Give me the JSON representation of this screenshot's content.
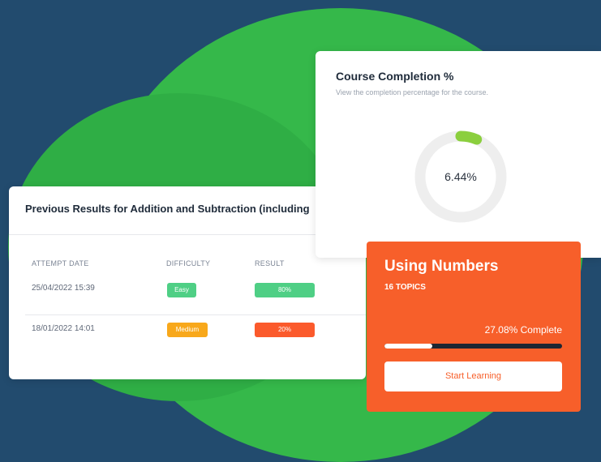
{
  "results_card": {
    "title": "Previous Results for Addition and Subtraction (including",
    "headers": {
      "date": "ATTEMPT DATE",
      "difficulty": "DIFFICULTY",
      "result": "RESULT"
    },
    "rows": [
      {
        "date": "25/04/2022 15:39",
        "difficulty": "Easy",
        "difficulty_color": "#4fcf85",
        "result": "80%",
        "result_color": "#4fcf85"
      },
      {
        "date": "18/01/2022 14:01",
        "difficulty": "Medium",
        "difficulty_color": "#f8a81b",
        "result": "20%",
        "result_color": "#fb5a2c"
      }
    ]
  },
  "completion_card": {
    "title": "Course Completion %",
    "subtitle": "View the completion percentage for the course.",
    "percent_label": "6.44%",
    "percent_value": 6.44,
    "ring_color": "#8bcf3e",
    "track_color": "#eeeeee"
  },
  "course_card": {
    "title": "Using Numbers",
    "topics": "16 TOPICS",
    "progress_label": "27.08% Complete",
    "progress_value": 27.08,
    "button_label": "Start Learning",
    "accent_color": "#f75f2a"
  }
}
